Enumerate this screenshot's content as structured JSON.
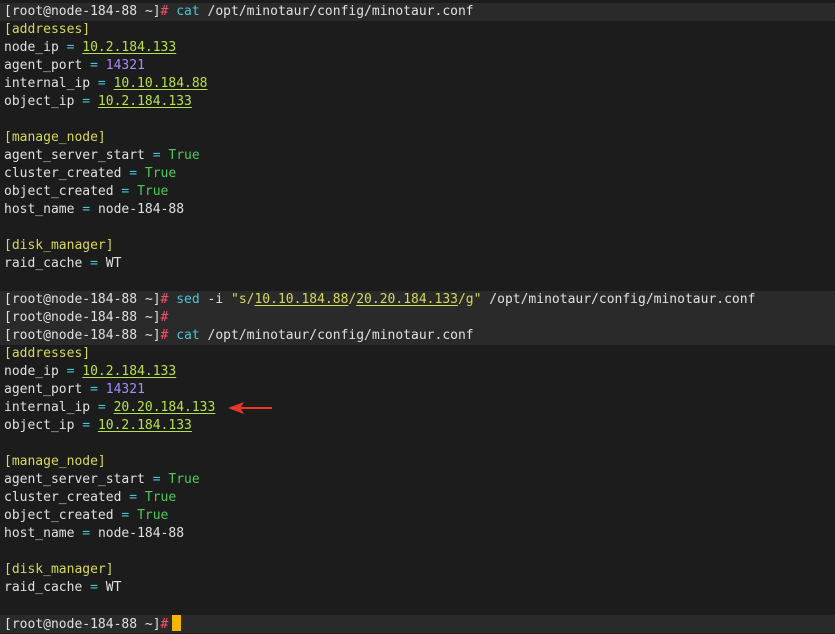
{
  "prompt": "[root@node-184-88 ~]",
  "hash": "#",
  "cmd_cat": "cat",
  "conf_path": "/opt/minotaur/config/minotaur.conf",
  "sed": {
    "cmd": "sed",
    "flag": "-i",
    "q1": "\"s/",
    "old_ip": "10.10.184.88",
    "slash": "/",
    "new_ip": "20.20.184.133",
    "tail": "/g\"",
    "path": "/opt/minotaur/config/minotaur.conf"
  },
  "eq": "=",
  "conf1": {
    "sec_addresses": "[addresses]",
    "node_ip_key": "node_ip",
    "node_ip": "10.2.184.133",
    "agent_port_key": "agent_port",
    "agent_port": "14321",
    "internal_ip_key": "internal_ip",
    "internal_ip": "10.10.184.88",
    "object_ip_key": "object_ip",
    "object_ip": "10.2.184.133",
    "sec_manage": "[manage_node]",
    "agent_server_start_key": "agent_server_start",
    "agent_server_start": "True",
    "cluster_created_key": "cluster_created",
    "cluster_created": "True",
    "object_created_key": "object_created",
    "object_created": "True",
    "host_name_key": "host_name",
    "host_name": "node-184-88",
    "sec_disk": "[disk_manager]",
    "raid_cache_key": "raid_cache",
    "raid_cache": "WT"
  },
  "conf2": {
    "sec_addresses": "[addresses]",
    "node_ip_key": "node_ip",
    "node_ip": "10.2.184.133",
    "agent_port_key": "agent_port",
    "agent_port": "14321",
    "internal_ip_key": "internal_ip",
    "internal_ip": "20.20.184.133",
    "object_ip_key": "object_ip",
    "object_ip": "10.2.184.133",
    "sec_manage": "[manage_node]",
    "agent_server_start_key": "agent_server_start",
    "agent_server_start": "True",
    "cluster_created_key": "cluster_created",
    "cluster_created": "True",
    "object_created_key": "object_created",
    "object_created": "True",
    "host_name_key": "host_name",
    "host_name": "node-184-88",
    "sec_disk": "[disk_manager]",
    "raid_cache_key": "raid_cache",
    "raid_cache": "WT"
  },
  "colors": {
    "background": "#1c1c1c",
    "prompt_highlight": "#2a2a2a",
    "cursor": "#f5b400",
    "arrow": "#e8362b"
  }
}
